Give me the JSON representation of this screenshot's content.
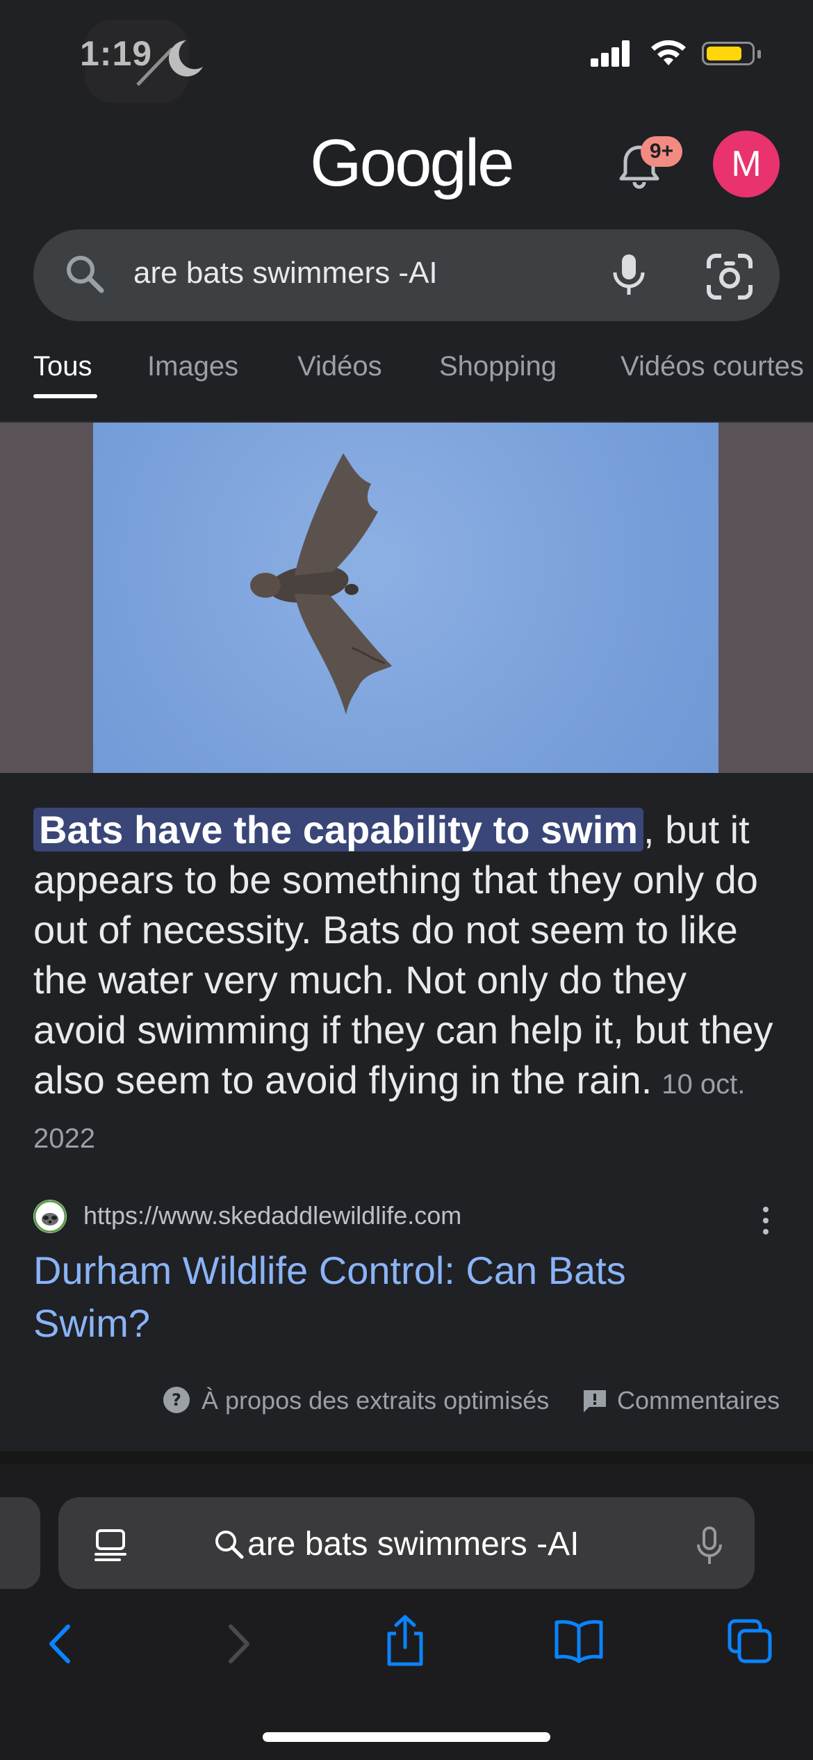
{
  "status_bar": {
    "time": "1:19",
    "battery_level": 0.75,
    "battery_color": "#ffd60a",
    "icons": [
      "moon-icon",
      "signal-icon",
      "wifi-icon",
      "battery-icon"
    ]
  },
  "header": {
    "logo": "Google",
    "notification_badge": "9+",
    "avatar_initial": "M",
    "avatar_color": "#e8336e"
  },
  "search": {
    "query": "are bats swimmers -AI",
    "icons": [
      "search-icon",
      "mic-icon",
      "lens-icon"
    ]
  },
  "tabs": [
    {
      "label": "Tous",
      "active": true
    },
    {
      "label": "Images",
      "active": false
    },
    {
      "label": "Vidéos",
      "active": false
    },
    {
      "label": "Shopping",
      "active": false
    },
    {
      "label": "Vidéos courtes",
      "active": false
    }
  ],
  "featured_snippet": {
    "highlight": "Bats have the capability to swim",
    "text": ", but it appears to be something that they only do out of necessity. Bats do not seem to like the water very much. Not only do they avoid swimming if they can help it, but they also seem to avoid flying in the rain.",
    "date": "10 oct. 2022",
    "source_url": "https://www.skedaddlewildlife.com",
    "title": "Durham Wildlife Control: Can Bats Swim?",
    "about_label": "À propos des extraits optimisés",
    "feedback_label": "Commentaires"
  },
  "safari": {
    "address_text": "are bats swimmers -AI",
    "accent_color": "#0a84ff",
    "nav_icons": [
      "back-icon",
      "forward-icon",
      "share-icon",
      "bookmarks-icon",
      "tabs-icon"
    ]
  }
}
